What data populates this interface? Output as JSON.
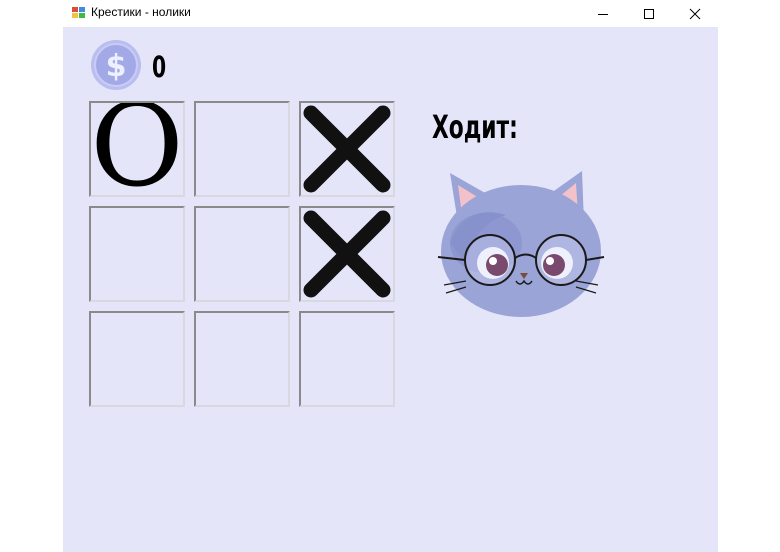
{
  "window": {
    "title": "Крестики - нолики"
  },
  "coins": {
    "icon": "dollar-coin-icon",
    "count": "0"
  },
  "board": {
    "cells": [
      "O",
      "",
      "X",
      "",
      "",
      "X",
      "",
      "",
      ""
    ]
  },
  "turn": {
    "label": "Ходит:",
    "player_avatar": "cat-with-glasses"
  },
  "colors": {
    "background": "#e5e5f9",
    "coin": "#a8aee6",
    "cat_body": "#9aa4d6"
  }
}
